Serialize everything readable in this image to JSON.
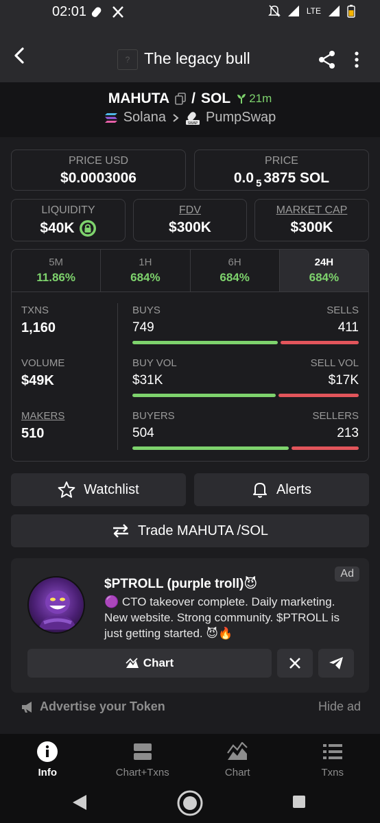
{
  "status_bar": {
    "time": "02:01",
    "network": "LTE"
  },
  "app_bar": {
    "title": "The legacy bull",
    "icon_placeholder": "?"
  },
  "pair": {
    "base": "MAHUTA",
    "separator": "/",
    "quote": "SOL",
    "age": "21m",
    "chain": "Solana",
    "dex": "PumpSwap"
  },
  "cards": {
    "price_usd": {
      "label": "PRICE USD",
      "value": "$0.0003006"
    },
    "price": {
      "label": "PRICE",
      "value_prefix": "0.0",
      "value_sub": "5",
      "value_suffix": "3875 SOL"
    },
    "liquidity": {
      "label": "LIQUIDITY",
      "value": "$40K"
    },
    "fdv": {
      "label": "FDV",
      "value": "$300K"
    },
    "market_cap": {
      "label": "MARKET CAP",
      "value": "$300K"
    }
  },
  "tabs": [
    {
      "label": "5M",
      "value": "11.86%"
    },
    {
      "label": "1H",
      "value": "684%"
    },
    {
      "label": "6H",
      "value": "684%"
    },
    {
      "label": "24H",
      "value": "684%"
    }
  ],
  "stats": {
    "txns": {
      "label": "TXNS",
      "value": "1,160"
    },
    "volume": {
      "label": "VOLUME",
      "value": "$49K"
    },
    "makers": {
      "label": "MAKERS",
      "value": "510"
    },
    "buys": {
      "label": "BUYS",
      "value": "749",
      "share": 0.65
    },
    "sells": {
      "label": "SELLS",
      "value": "411"
    },
    "buy_vol": {
      "label": "BUY VOL",
      "value": "$31K",
      "share": 0.64
    },
    "sell_vol": {
      "label": "SELL VOL",
      "value": "$17K"
    },
    "buyers": {
      "label": "BUYERS",
      "value": "504",
      "share": 0.7
    },
    "sellers": {
      "label": "SELLERS",
      "value": "213"
    }
  },
  "actions": {
    "watchlist": "Watchlist",
    "alerts": "Alerts",
    "trade": "Trade MAHUTA /SOL"
  },
  "ad": {
    "badge": "Ad",
    "title": "$PTROLL (purple troll)",
    "title_emoji": "😈",
    "bullet_emoji": "🟣",
    "description": " CTO takeover complete. Daily marketing. New website. Strong community. $PTROLL is just getting started. ",
    "trailing_emojis": "😈🔥",
    "chart_button": "Chart"
  },
  "advertise": {
    "label": "Advertise your Token",
    "hide": "Hide ad"
  },
  "bottom_nav": [
    {
      "label": "Info"
    },
    {
      "label": "Chart+Txns"
    },
    {
      "label": "Chart"
    },
    {
      "label": "Txns"
    }
  ],
  "colors": {
    "green": "#7ed36d",
    "red": "#e2555b",
    "background": "#1c1c1f"
  }
}
